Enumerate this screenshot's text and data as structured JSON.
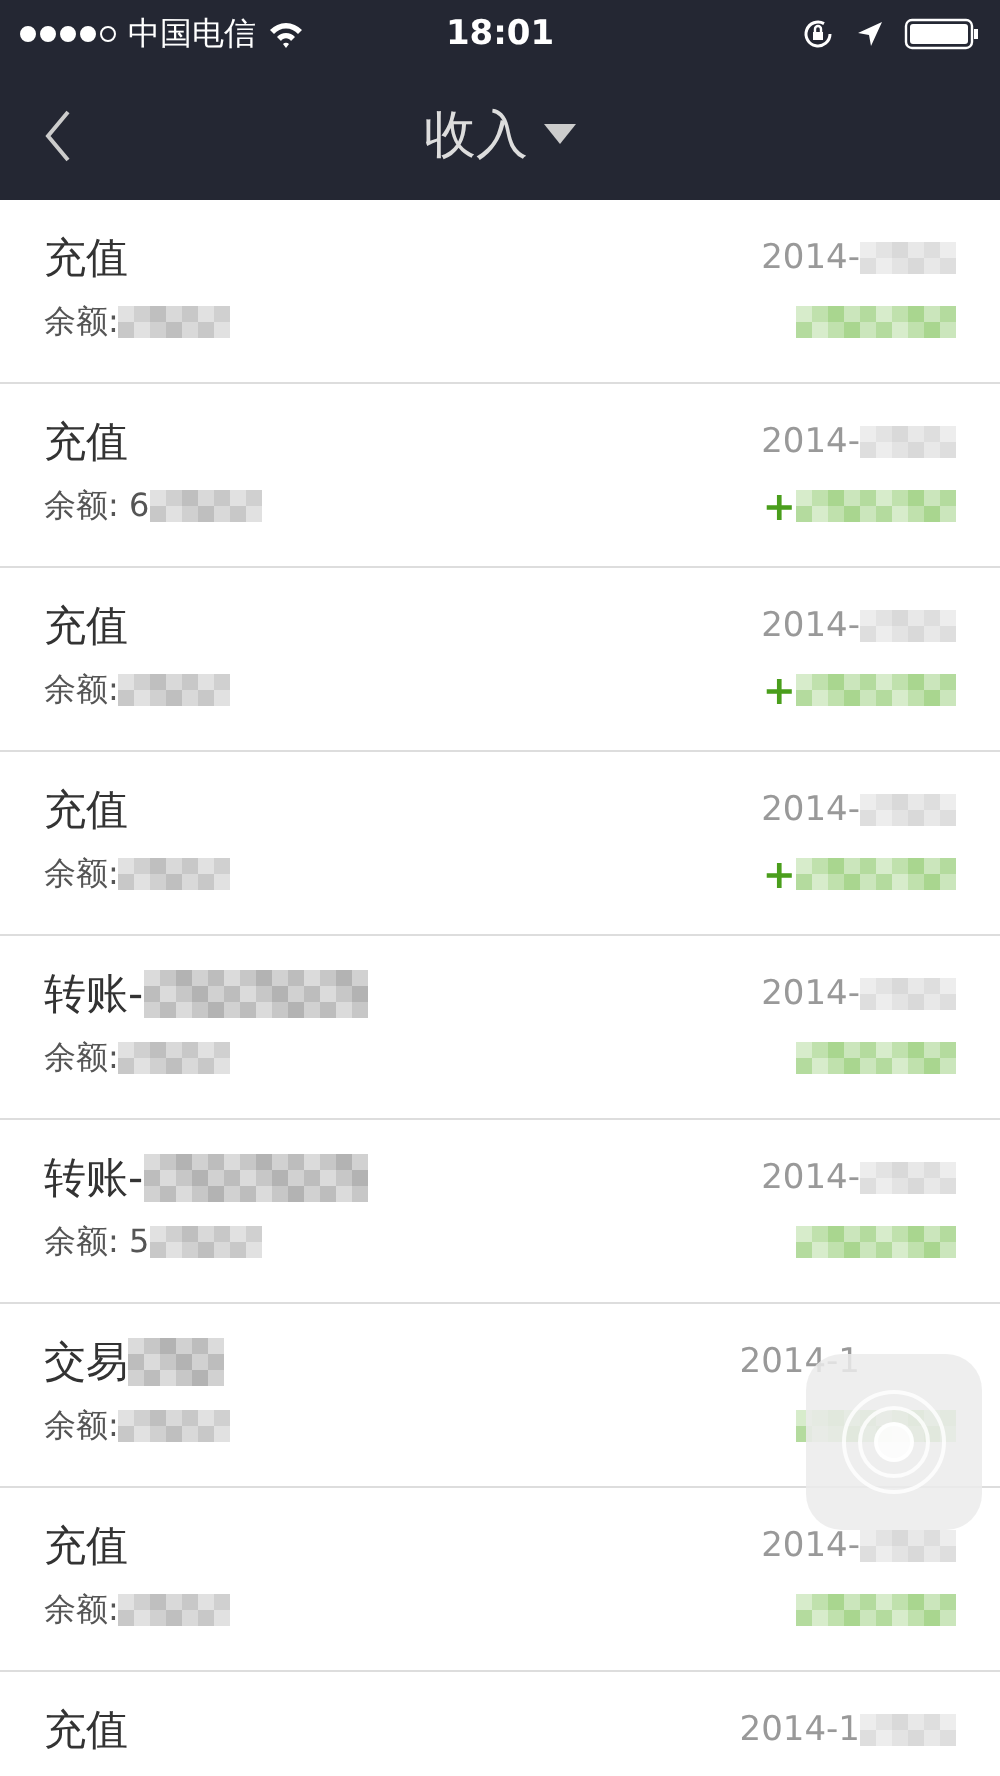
{
  "status_bar": {
    "signal_dots": [
      {
        "on": true
      },
      {
        "on": true
      },
      {
        "on": true
      },
      {
        "on": true
      },
      {
        "on": false
      }
    ],
    "carrier": "中国电信",
    "time": "18:01"
  },
  "nav": {
    "title": "收入"
  },
  "records": [
    {
      "title": "充值",
      "title_redacted": false,
      "balance": "余额:",
      "date": "2014-"
    },
    {
      "title": "充值",
      "title_redacted": false,
      "balance": "余额: 6",
      "date": "2014-",
      "amount": "+"
    },
    {
      "title": "充值",
      "title_redacted": false,
      "balance": "余额:",
      "date": "2014-",
      "amount": "+"
    },
    {
      "title": "充值",
      "title_redacted": false,
      "balance": "余额:",
      "date": "2014-",
      "amount": "+"
    },
    {
      "title": "转账-",
      "title_redacted": true,
      "balance": "余额:",
      "date": "2014-"
    },
    {
      "title": "转账-",
      "title_redacted": true,
      "balance": "余额: 5",
      "date": "2014-"
    },
    {
      "title": "交易",
      "title_redacted": true,
      "balance": "余额:",
      "date": "2014-1"
    },
    {
      "title": "充值",
      "title_redacted": false,
      "balance": "余额:",
      "date": "2014-"
    },
    {
      "title": "充值",
      "title_redacted": false,
      "date": "2014-1"
    }
  ]
}
